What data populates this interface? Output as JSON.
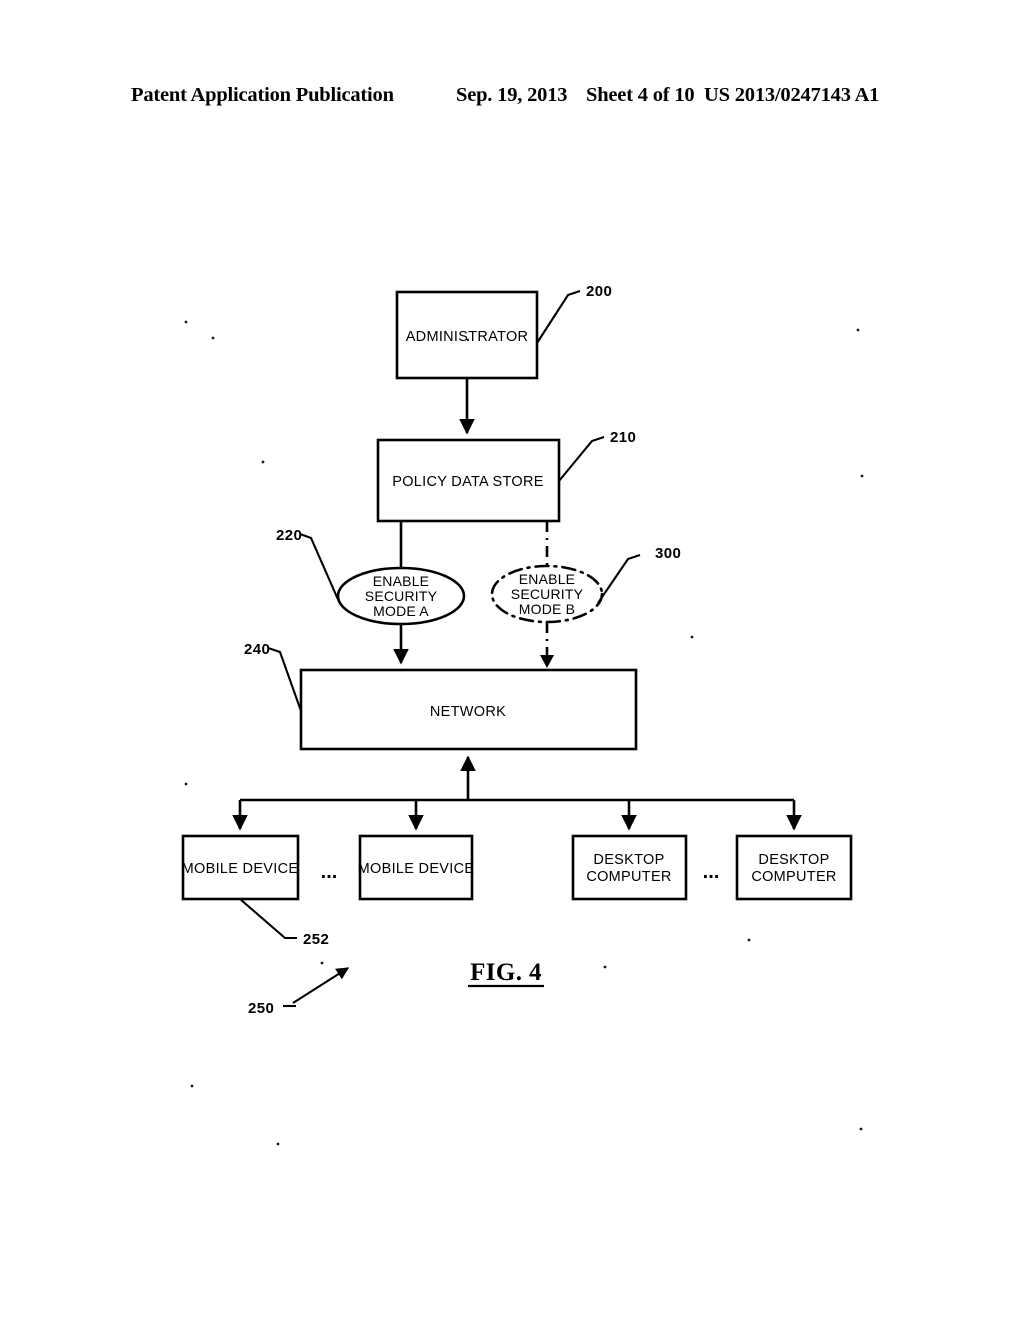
{
  "header": {
    "publication": "Patent Application Publication",
    "date": "Sep. 19, 2013",
    "sheet": "Sheet 4 of 10",
    "patent_number": "US 2013/0247143 A1"
  },
  "figure": {
    "caption": "FIG. 4",
    "nodes": {
      "administrator": {
        "label": "ADMINISTRATOR",
        "ref": "200"
      },
      "policy_data_store": {
        "label": "POLICY DATA STORE",
        "ref": "210"
      },
      "security_mode_a": {
        "line1": "ENABLE",
        "line2": "SECURITY",
        "line3": "MODE A",
        "ref": "220",
        "border": "solid"
      },
      "security_mode_b": {
        "line1": "ENABLE",
        "line2": "SECURITY",
        "line3": "MODE B",
        "ref": "300",
        "border": "dash-dot"
      },
      "network": {
        "label": "NETWORK",
        "ref": "240"
      },
      "mobile_device_1": {
        "label": "MOBILE DEVICE",
        "ref": "252"
      },
      "mobile_device_2": {
        "label": "MOBILE DEVICE"
      },
      "desktop_computer_1": {
        "line1": "DESKTOP",
        "line2": "COMPUTER"
      },
      "desktop_computer_2": {
        "line1": "DESKTOP",
        "line2": "COMPUTER"
      },
      "device_group": {
        "ref": "250"
      }
    },
    "ellipsis": {
      "mobile_gap": "...",
      "desktop_gap": "..."
    }
  }
}
